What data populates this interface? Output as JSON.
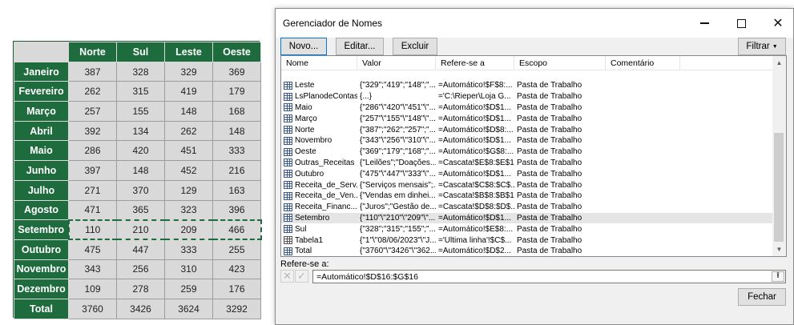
{
  "sheet": {
    "headers": [
      "Norte",
      "Sul",
      "Leste",
      "Oeste"
    ],
    "rows": [
      {
        "label": "Janeiro",
        "values": [
          "387",
          "328",
          "329",
          "369"
        ]
      },
      {
        "label": "Fevereiro",
        "values": [
          "262",
          "315",
          "419",
          "179"
        ]
      },
      {
        "label": "Março",
        "values": [
          "257",
          "155",
          "148",
          "168"
        ]
      },
      {
        "label": "Abril",
        "values": [
          "392",
          "134",
          "262",
          "148"
        ]
      },
      {
        "label": "Maio",
        "values": [
          "286",
          "420",
          "451",
          "333"
        ]
      },
      {
        "label": "Junho",
        "values": [
          "397",
          "148",
          "452",
          "216"
        ]
      },
      {
        "label": "Julho",
        "values": [
          "271",
          "370",
          "129",
          "163"
        ]
      },
      {
        "label": "Agosto",
        "values": [
          "471",
          "365",
          "323",
          "396"
        ]
      },
      {
        "label": "Setembro",
        "values": [
          "110",
          "210",
          "209",
          "466"
        ]
      },
      {
        "label": "Outubro",
        "values": [
          "475",
          "447",
          "333",
          "255"
        ]
      },
      {
        "label": "Novembro",
        "values": [
          "343",
          "256",
          "310",
          "423"
        ]
      },
      {
        "label": "Dezembro",
        "values": [
          "109",
          "278",
          "259",
          "176"
        ]
      },
      {
        "label": "Total",
        "values": [
          "3760",
          "3426",
          "3624",
          "3292"
        ]
      }
    ]
  },
  "dialog": {
    "title": "Gerenciador de Nomes",
    "buttons": {
      "novo": "Novo...",
      "editar": "Editar...",
      "excluir": "Excluir",
      "filtrar": "Filtrar",
      "fechar": "Fechar"
    },
    "columns": [
      "Nome",
      "Valor",
      "Refere-se a",
      "Escopo",
      "Comentário"
    ],
    "names": [
      {
        "nome": "Leste",
        "valor": "{\"329\";\"419\";\"148\";\"...",
        "ref": "=Automático!$F$8:...",
        "escopo": "Pasta de Trabalho",
        "icon": "table-icon"
      },
      {
        "nome": "LsPlanodeContas",
        "valor": "{...}",
        "ref": "='C:\\Rieper\\Loja G...",
        "escopo": "Pasta de Trabalho",
        "icon": "table-icon"
      },
      {
        "nome": "Maio",
        "valor": "{\"286\"\\\"420\"\\\"451\"\\\"...",
        "ref": "=Automático!$D$1...",
        "escopo": "Pasta de Trabalho",
        "icon": "table-icon"
      },
      {
        "nome": "Março",
        "valor": "{\"257\"\\\"155\"\\\"148\"\\\"...",
        "ref": "=Automático!$D$1...",
        "escopo": "Pasta de Trabalho",
        "icon": "table-icon"
      },
      {
        "nome": "Norte",
        "valor": "{\"387\";\"262\";\"257\";\"...",
        "ref": "=Automático!$D$8:...",
        "escopo": "Pasta de Trabalho",
        "icon": "table-icon"
      },
      {
        "nome": "Novembro",
        "valor": "{\"343\"\\\"256\"\\\"310\"\\\"...",
        "ref": "=Automático!$D$1...",
        "escopo": "Pasta de Trabalho",
        "icon": "table-icon"
      },
      {
        "nome": "Oeste",
        "valor": "{\"369\";\"179\";\"168\";\"...",
        "ref": "=Automático!$G$8:...",
        "escopo": "Pasta de Trabalho",
        "icon": "table-icon"
      },
      {
        "nome": "Outras_Receitas",
        "valor": "{\"Leilões\";\"Doações...",
        "ref": "=Cascata!$E$8:$E$15",
        "escopo": "Pasta de Trabalho",
        "icon": "table-icon"
      },
      {
        "nome": "Outubro",
        "valor": "{\"475\"\\\"447\"\\\"333\"\\\"...",
        "ref": "=Automático!$D$1...",
        "escopo": "Pasta de Trabalho",
        "icon": "table-icon"
      },
      {
        "nome": "Receita_de_Serv...",
        "valor": "{\"Serviços mensais\";...",
        "ref": "=Cascata!$C$8:$C$...",
        "escopo": "Pasta de Trabalho",
        "icon": "table-icon"
      },
      {
        "nome": "Receita_de_Ven...",
        "valor": "{\"Vendas em dinhei...",
        "ref": "=Cascata!$B$8:$B$15",
        "escopo": "Pasta de Trabalho",
        "icon": "table-icon"
      },
      {
        "nome": "Receita_Financ...",
        "valor": "{\"Juros\";\"Gestão de...",
        "ref": "=Cascata!$D$8:$D$...",
        "escopo": "Pasta de Trabalho",
        "icon": "table-icon"
      },
      {
        "nome": "Setembro",
        "valor": "{\"110\"\\\"210\"\\\"209\"\\\"...",
        "ref": "=Automático!$D$1...",
        "escopo": "Pasta de Trabalho",
        "icon": "table-icon",
        "selected": true
      },
      {
        "nome": "Sul",
        "valor": "{\"328\";\"315\";\"155\";\"...",
        "ref": "=Automático!$E$8:...",
        "escopo": "Pasta de Trabalho",
        "icon": "table-icon"
      },
      {
        "nome": "Tabela1",
        "valor": "{\"1\"\\\"08/06/2023\"\\\"J...",
        "ref": "='Última linha'!$C$...",
        "escopo": "Pasta de Trabalho",
        "icon": "excel-table-icon"
      },
      {
        "nome": "Total",
        "valor": "{\"3760\"\\\"3426\"\\\"362...",
        "ref": "=Automático!$D$2...",
        "escopo": "Pasta de Trabalho",
        "icon": "table-icon"
      }
    ],
    "refers_label": "Refere-se a:",
    "refers_value": "=Automático!$D$16:$G$16"
  },
  "colors": {
    "sheet_header": "#1e6b3e",
    "sheet_cell": "#d9d9d9",
    "dialog_bg": "#f0f0f0",
    "selection": "#e5e5e5"
  }
}
